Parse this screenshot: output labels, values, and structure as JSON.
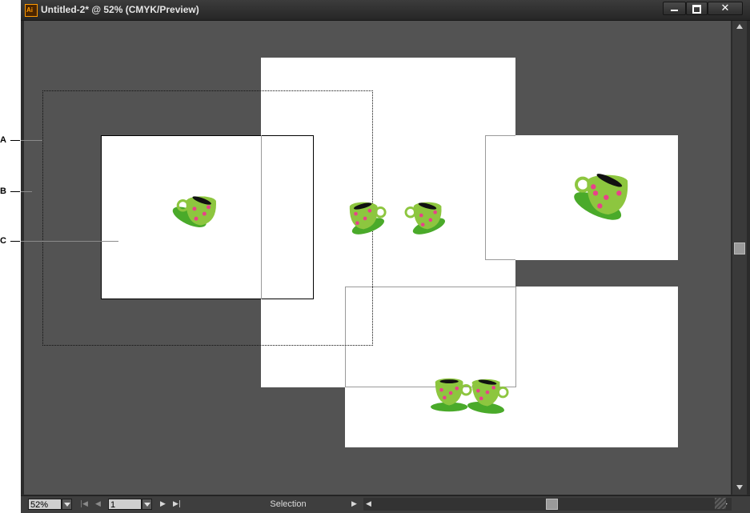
{
  "window": {
    "title": "Untitled-2* @ 52% (CMYK/Preview)",
    "app_icon_label": "Ai"
  },
  "callouts": {
    "a": "A",
    "b": "B",
    "c": "C"
  },
  "status": {
    "zoom": "52%",
    "page": "1",
    "tool": "Selection"
  },
  "icons": {
    "minimize": "minimize-icon",
    "maximize": "maximize-icon",
    "close": "close-icon",
    "cup": "teacup-icon"
  },
  "colors": {
    "canvas": "#535353",
    "artboard": "#ffffff",
    "cup_green": "#8dc63f",
    "saucer_green": "#4aaa2a",
    "dots_pink": "#e8418a",
    "app_accent": "#ff9a00"
  }
}
